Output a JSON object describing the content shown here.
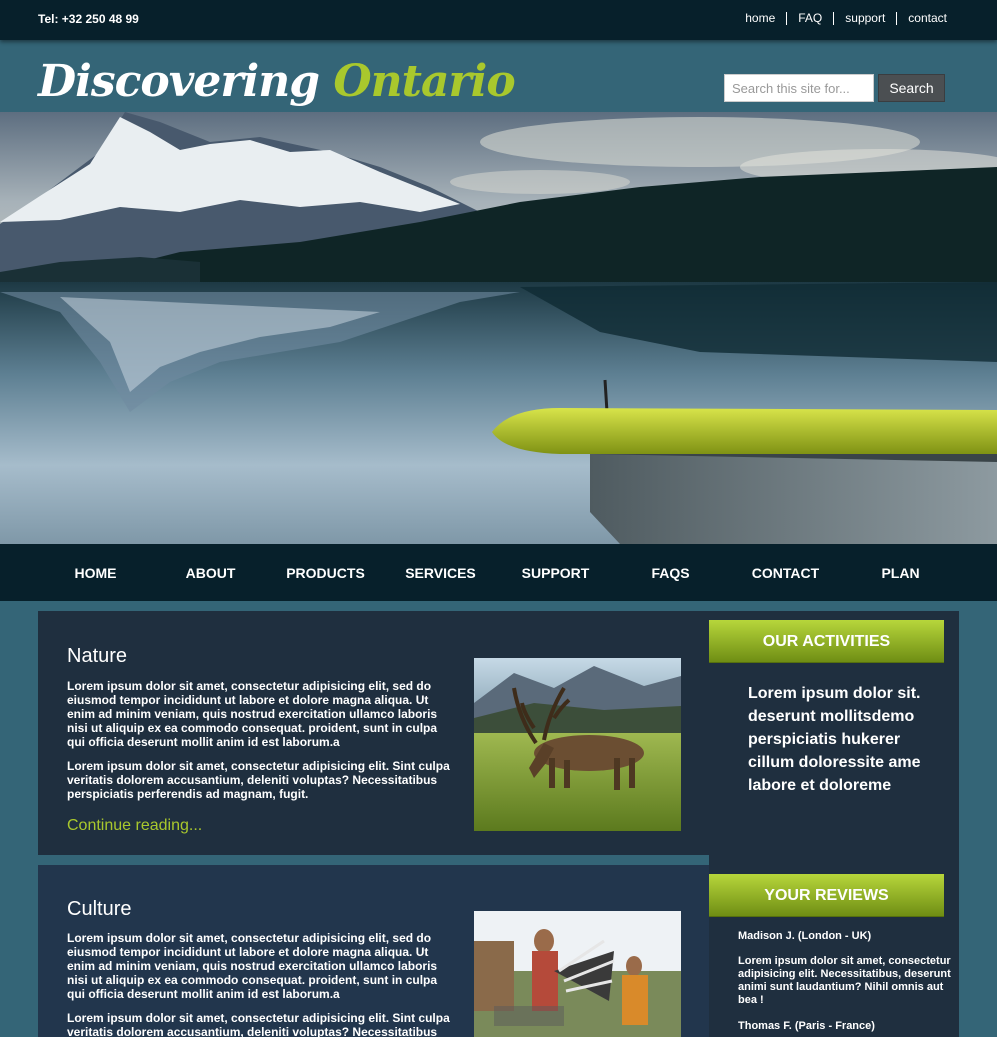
{
  "topbar": {
    "phone": "Tel: +32 250 48 99",
    "links": [
      "home",
      "FAQ",
      "support",
      "contact"
    ]
  },
  "header": {
    "logo_word1": "Discovering",
    "logo_word2": "Ontario",
    "search_placeholder": "Search this site for...",
    "search_button": "Search"
  },
  "nav": {
    "items": [
      "HOME",
      "ABOUT",
      "PRODUCTS",
      "SERVICES",
      "SUPPORT",
      "FAQS",
      "CONTACT",
      "PLAN"
    ]
  },
  "articles": [
    {
      "title": "Nature",
      "para1": "Lorem ipsum dolor sit amet, consectetur adipisicing elit, sed do eiusmod tempor incididunt ut labore et dolore magna aliqua. Ut enim ad minim veniam, quis nostrud exercitation ullamco laboris nisi ut aliquip ex ea commodo consequat. proident, sunt in culpa qui officia deserunt mollit anim id est laborum.a",
      "para2": "Lorem ipsum dolor sit amet, consectetur adipisicing elit. Sint culpa veritatis dolorem accusantium, deleniti voluptas? Necessitatibus perspiciatis perferendis ad magnam, fugit.",
      "more": "Continue reading..."
    },
    {
      "title": "Culture",
      "para1": "Lorem ipsum dolor sit amet, consectetur adipisicing elit, sed do eiusmod tempor incididunt ut labore et dolore magna aliqua. Ut enim ad minim veniam, quis nostrud exercitation ullamco laboris nisi ut aliquip ex ea commodo consequat. proident, sunt in culpa qui officia deserunt mollit anim id est laborum.a",
      "para2": "Lorem ipsum dolor sit amet, consectetur adipisicing elit. Sint culpa veritatis dolorem accusantium, deleniti voluptas? Necessitatibus"
    }
  ],
  "sidebar": {
    "activities_title": "OUR ACTIVITIES",
    "activities_text": "Lorem ipsum dolor sit. deserunt mollitsdemo perspiciatis hukerer cillum doloressite ame labore et doloreme",
    "reviews_title": "YOUR REVIEWS",
    "reviews": [
      {
        "author": "Madison J. (London - UK)",
        "text": "Lorem ipsum dolor sit amet, consectetur adipisicing elit. Necessitatibus, deserunt animi sunt laudantium? Nihil omnis aut bea !"
      },
      {
        "author": "Thomas F. (Paris - France)"
      }
    ]
  },
  "colors": {
    "page_bg": "#346577",
    "bar_dark": "#07202b",
    "accent_green": "#a9c82d",
    "card_bg": "#1f2f3f"
  }
}
